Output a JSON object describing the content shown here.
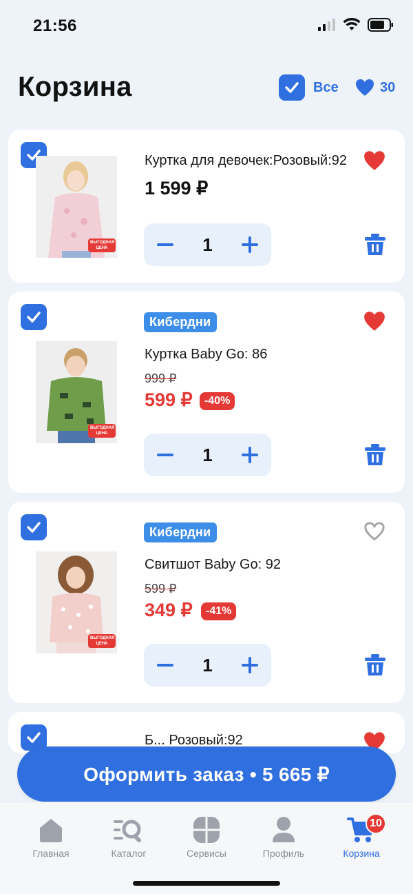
{
  "status_bar": {
    "time": "21:56"
  },
  "header": {
    "title": "Корзина",
    "select_all_label": "Все",
    "favorites_count": "30"
  },
  "colors": {
    "accent": "#2f6fe0",
    "sale": "#e53935",
    "brand_badge": "#3d8ee8"
  },
  "cart": {
    "items": [
      {
        "checked": true,
        "name": "Куртка для девочек:Розовый:92",
        "price": "1 599 ₽",
        "promo_badge": "ВЫГОДНАЯ ЦЕНА",
        "quantity": "1",
        "favorited": true
      },
      {
        "checked": true,
        "brand": "Кибердни",
        "name": "Куртка Baby Go: 86",
        "old_price": "999 ₽",
        "price": "599 ₽",
        "discount": "-40%",
        "promo_badge": "ВЫГОДНАЯ ЦЕНА",
        "quantity": "1",
        "favorited": true
      },
      {
        "checked": true,
        "brand": "Кибердни",
        "name": "Свитшот Baby Go: 92",
        "old_price": "599 ₽",
        "price": "349 ₽",
        "discount": "-41%",
        "promo_badge": "ВЫГОДНАЯ ЦЕНА",
        "quantity": "1",
        "favorited": false
      },
      {
        "checked": true,
        "name": "Б... Розовый:92",
        "favorited": true
      }
    ]
  },
  "checkout": {
    "label": "Оформить заказ • 5 665 ₽"
  },
  "tab_bar": {
    "tabs": [
      {
        "label": "Главная",
        "icon": "home-icon",
        "active": false
      },
      {
        "label": "Каталог",
        "icon": "catalog-search-icon",
        "active": false
      },
      {
        "label": "Сервисы",
        "icon": "services-grid-icon",
        "active": false
      },
      {
        "label": "Профиль",
        "icon": "profile-icon",
        "active": false
      },
      {
        "label": "Корзина",
        "icon": "cart-icon",
        "active": true,
        "badge": "10"
      }
    ]
  }
}
